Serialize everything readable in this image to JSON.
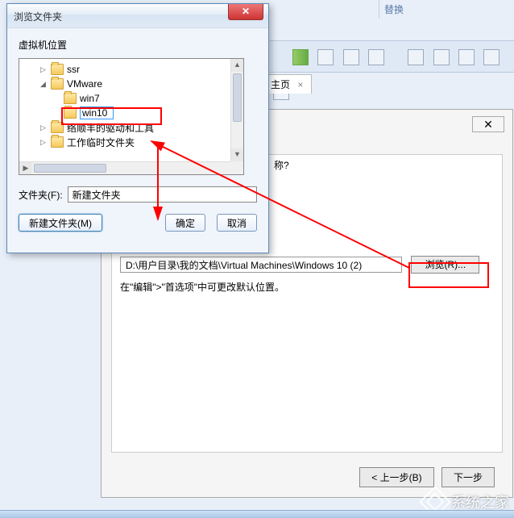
{
  "bg": {
    "header_text": "替换",
    "tab_label": "主页",
    "tab_close": "×",
    "wizard_close": "✕",
    "question_suffix": "称?",
    "path_value": "D:\\用户目录\\我的文档\\Virtual Machines\\Windows 10 (2)",
    "browse_label": "浏览(R)...",
    "hint_text": "在\"编辑\">\"首选项\"中可更改默认位置。",
    "back_btn": "< 上一步(B)",
    "next_btn": "下一步"
  },
  "dialog": {
    "title": "浏览文件夹",
    "close": "✕",
    "section_label": "虚拟机位置",
    "tree": {
      "items": [
        {
          "label": "ssr",
          "indent": 1,
          "expander": "▷",
          "editing": false
        },
        {
          "label": "VMware",
          "indent": 1,
          "expander": "◢",
          "editing": false
        },
        {
          "label": "win7",
          "indent": 2,
          "expander": "",
          "editing": false
        },
        {
          "label": "win10",
          "indent": 2,
          "expander": "",
          "editing": true
        },
        {
          "label": "络顺丰的驱动和工具",
          "indent": 1,
          "expander": "▷",
          "editing": false
        },
        {
          "label": "工作临时文件夹",
          "indent": 1,
          "expander": "▷",
          "editing": false
        }
      ]
    },
    "folder_label": "文件夹(F):",
    "folder_value": "新建文件夹",
    "new_folder_btn": "新建文件夹(M)",
    "ok_btn": "确定",
    "cancel_btn": "取消"
  },
  "watermark": "系统之家"
}
